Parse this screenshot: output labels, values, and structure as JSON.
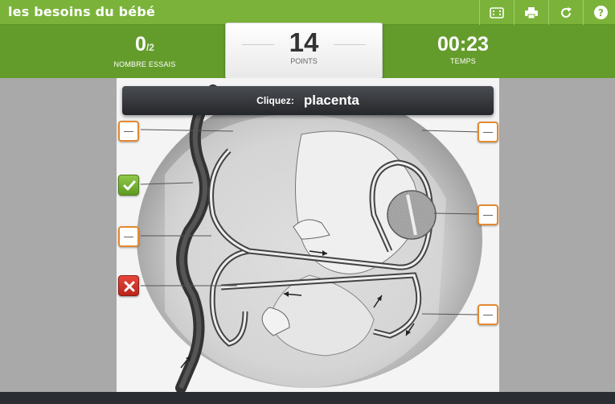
{
  "app": {
    "title": "les besoins du bébé"
  },
  "toolbar": [
    {
      "name": "fullscreen-button",
      "icon": "fullscreen-icon"
    },
    {
      "name": "print-button",
      "icon": "print-icon"
    },
    {
      "name": "restart-button",
      "icon": "restart-icon"
    },
    {
      "name": "help-button",
      "icon": "help-icon"
    }
  ],
  "stats": {
    "attempts": {
      "value": "0",
      "total": "/2",
      "label": "NOMBRE ESSAIS"
    },
    "points": {
      "value": "14",
      "label": "POINTS"
    },
    "time": {
      "value": "00:23",
      "label": "TEMPS"
    }
  },
  "prompt": {
    "lead": "Cliquez:",
    "target": "placenta"
  },
  "markers": [
    {
      "name": "label-marker-1",
      "state": "empty"
    },
    {
      "name": "label-marker-2",
      "state": "correct"
    },
    {
      "name": "label-marker-3",
      "state": "empty"
    },
    {
      "name": "label-marker-4",
      "state": "wrong"
    },
    {
      "name": "label-marker-5",
      "state": "empty"
    },
    {
      "name": "label-marker-6",
      "state": "empty"
    },
    {
      "name": "label-marker-7",
      "state": "empty"
    }
  ],
  "colors": {
    "header_green": "#7bb33a",
    "score_green": "#649c2c",
    "marker_orange": "#e28a33",
    "correct_green": "#6aa82b",
    "wrong_red": "#c9302c"
  }
}
